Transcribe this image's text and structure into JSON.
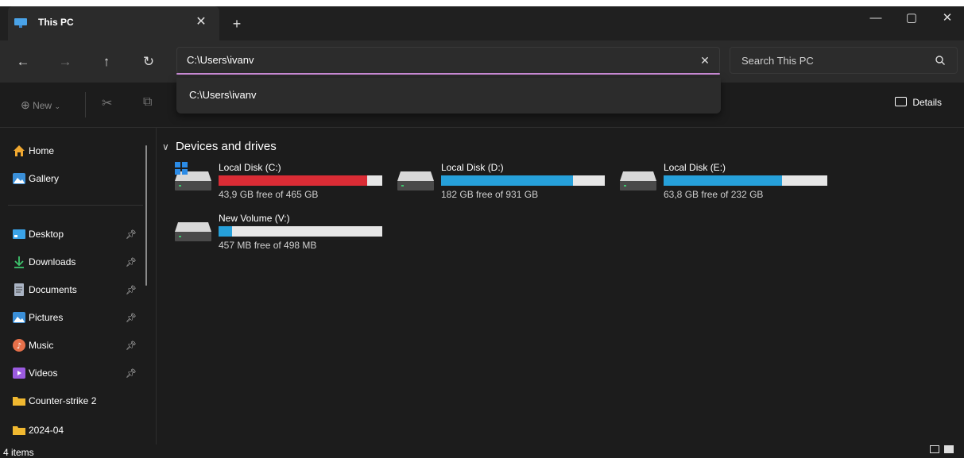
{
  "tab": {
    "title": "This PC",
    "close": "✕",
    "new": "+"
  },
  "window": {
    "minimize": "—",
    "maximize": "▢",
    "close": "✕"
  },
  "nav": {
    "back": "←",
    "forward": "→",
    "up": "↑",
    "refresh": "↻"
  },
  "address": {
    "value": "C:\\Users\\ivanv",
    "clear": "✕"
  },
  "suggestion": "C:\\Users\\ivanv",
  "search": {
    "placeholder": "Search This PC"
  },
  "command": {
    "new_label": "New",
    "details_label": "Details"
  },
  "sidebar": {
    "top": [
      {
        "label": "Home",
        "icon": "home-icon"
      },
      {
        "label": "Gallery",
        "icon": "gallery-icon"
      }
    ],
    "pinned": [
      {
        "label": "Desktop",
        "icon": "desktop-icon"
      },
      {
        "label": "Downloads",
        "icon": "downloads-icon"
      },
      {
        "label": "Documents",
        "icon": "documents-icon"
      },
      {
        "label": "Pictures",
        "icon": "pictures-icon"
      },
      {
        "label": "Music",
        "icon": "music-icon"
      },
      {
        "label": "Videos",
        "icon": "videos-icon"
      },
      {
        "label": "Counter-strike 2",
        "icon": "folder-icon"
      },
      {
        "label": "2024-04",
        "icon": "folder-icon"
      }
    ]
  },
  "group": {
    "title": "Devices and drives"
  },
  "drives": [
    {
      "name": "Local Disk (C:)",
      "info": "43,9 GB free of 465 GB",
      "used_fraction": 0.906,
      "color": "#da2c35",
      "system": true
    },
    {
      "name": "Local Disk (D:)",
      "info": "182 GB free of 931 GB",
      "used_fraction": 0.805,
      "color": "#26a0da",
      "system": false
    },
    {
      "name": "Local Disk (E:)",
      "info": "63,8 GB free of 232 GB",
      "used_fraction": 0.725,
      "color": "#26a0da",
      "system": false
    },
    {
      "name": "New Volume (V:)",
      "info": "457 MB free of 498 MB",
      "used_fraction": 0.082,
      "color": "#26a0da",
      "system": false
    }
  ],
  "status": {
    "items": "4 items"
  }
}
